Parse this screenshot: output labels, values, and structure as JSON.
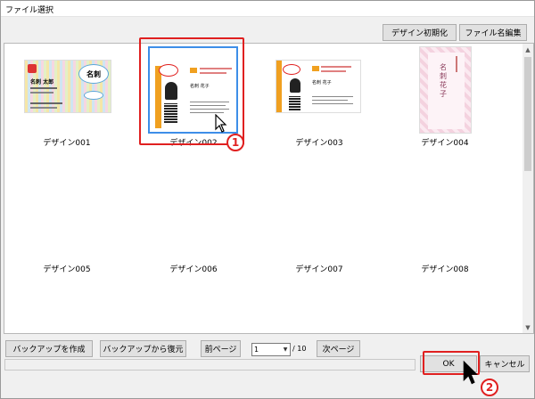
{
  "window": {
    "title": "ファイル選択"
  },
  "toolbar": {
    "reset_label": "デザイン初期化",
    "rename_label": "ファイル名編集"
  },
  "designs": [
    {
      "label": "デザイン001"
    },
    {
      "label": "デザイン002"
    },
    {
      "label": "デザイン003"
    },
    {
      "label": "デザイン004"
    },
    {
      "label": "デザイン005"
    },
    {
      "label": "デザイン006"
    },
    {
      "label": "デザイン007"
    },
    {
      "label": "デザイン008"
    }
  ],
  "cards": {
    "c1": {
      "name": "名刺 太郎",
      "bubble": "名刺"
    },
    "c2": {
      "name": "名刺 花子"
    },
    "c3": {
      "name": "名刺 花子"
    },
    "c4": {
      "title": "名刺 花子"
    }
  },
  "bottom": {
    "backup_create": "バックアップを作成",
    "backup_restore": "バックアップから復元",
    "prev_page": "前ページ",
    "page_value": "1",
    "page_total": "/ 10",
    "next_page": "次ページ",
    "ok": "OK",
    "cancel": "キャンセル"
  },
  "annotations": {
    "step1": "1",
    "step2": "2"
  },
  "colors": {
    "callout": "#e02020",
    "selection": "#3d8ee8",
    "button": "#e1e1e1"
  },
  "icons": {
    "scroll_up": "triangle-up-icon",
    "scroll_down": "triangle-down-icon",
    "pointer": "arrow-cursor-icon",
    "dropdown": "chevron-down-icon"
  }
}
